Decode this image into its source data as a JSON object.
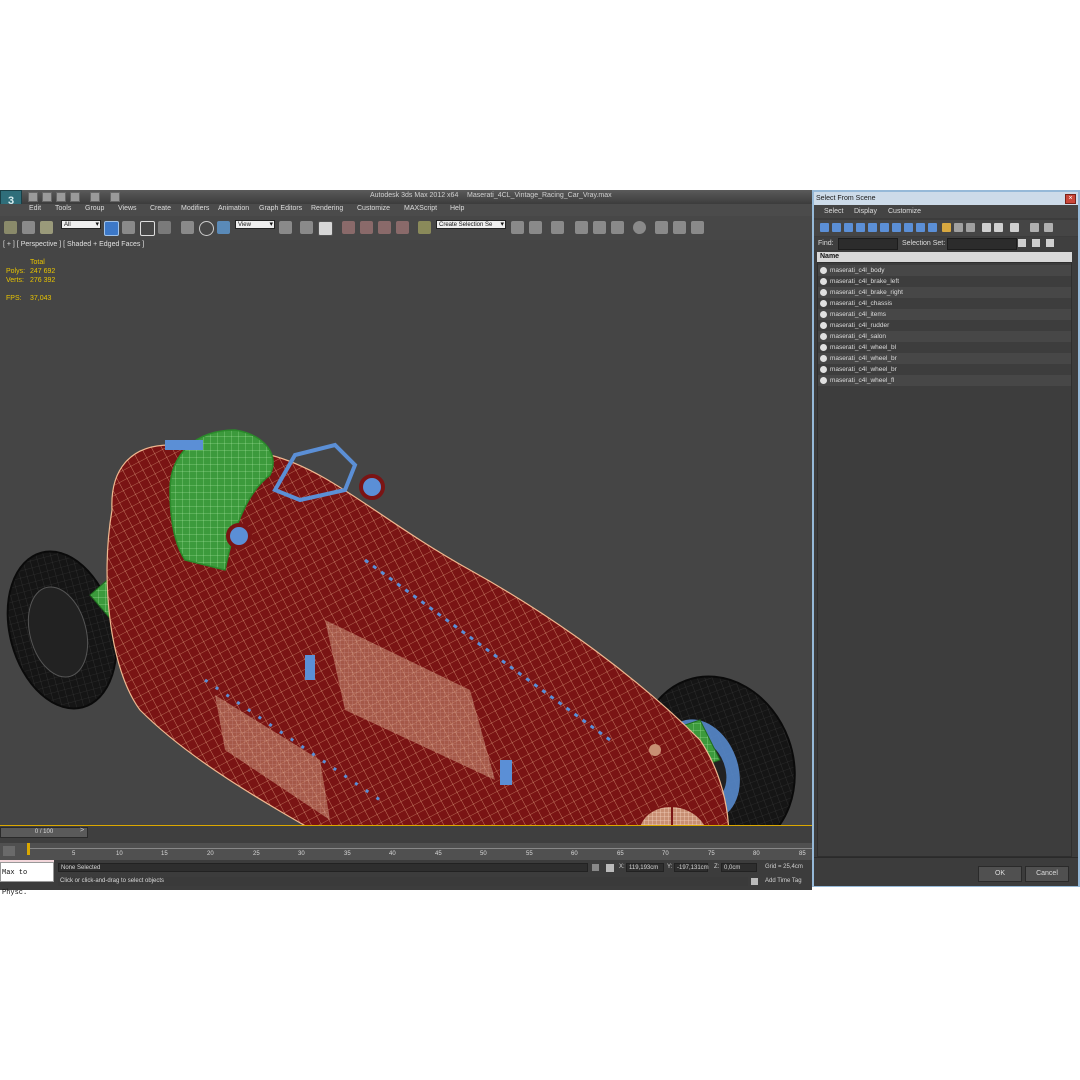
{
  "window": {
    "title_app": "Autodesk 3ds Max  2012 x64",
    "title_file": "Maserati_4CL_Vintage_Racing_Car_Vray.max"
  },
  "menu": [
    "Edit",
    "Tools",
    "Group",
    "Views",
    "Create",
    "Modifiers",
    "Animation",
    "Graph Editors",
    "Rendering",
    "Customize",
    "MAXScript",
    "Help"
  ],
  "toolbar": {
    "selection_filter": "All",
    "ref_coord": "View",
    "named_selection": "Create Selection Se"
  },
  "viewport": {
    "label": "[ + ] [ Perspective ] [ Shaded + Edged Faces ]",
    "stats": {
      "total_label": "Total",
      "polys_label": "Polys:",
      "polys_value": "247 692",
      "verts_label": "Verts:",
      "verts_value": "276 392",
      "fps_label": "FPS:",
      "fps_value": "37,043"
    }
  },
  "timeline": {
    "slider": "0 / 100",
    "ticks": [
      "5",
      "10",
      "15",
      "20",
      "25",
      "30",
      "35",
      "40",
      "45",
      "50",
      "55",
      "60",
      "65",
      "70",
      "75",
      "80",
      "85"
    ]
  },
  "status": {
    "maxscript_text": "Max to Physc.",
    "selection": "None Selected",
    "prompt": "Click or click-and-drag to select objects",
    "x_label": "X:",
    "x_value": "119,193cm",
    "y_label": "Y:",
    "y_value": "-197,131cm",
    "z_label": "Z:",
    "z_value": "0,0cm",
    "grid": "Grid = 25,4cm",
    "add_time_tag": "Add Time Tag"
  },
  "dialog": {
    "title": "Select From Scene",
    "menu": [
      "Select",
      "Display",
      "Customize"
    ],
    "find_label": "Find:",
    "selection_set_label": "Selection Set:",
    "list_header": "Name",
    "items": [
      "maserati_c4l_body",
      "maserati_c4l_brake_left",
      "maserati_c4l_brake_right",
      "maserati_c4l_chassis",
      "maserati_c4l_items",
      "maserati_c4l_rudder",
      "maserati_c4l_salon",
      "maserati_c4l_wheel_bl",
      "maserati_c4l_wheel_br",
      "maserati_c4l_wheel_br",
      "maserati_c4l_wheel_fl"
    ],
    "ok_label": "OK",
    "cancel_label": "Cancel"
  },
  "colors": {
    "body_mesh": "#7a1414",
    "wire": "#f0b890",
    "interior": "#3c9a3c",
    "parts": "#5b8fd6",
    "stats_text": "#e8c400"
  }
}
